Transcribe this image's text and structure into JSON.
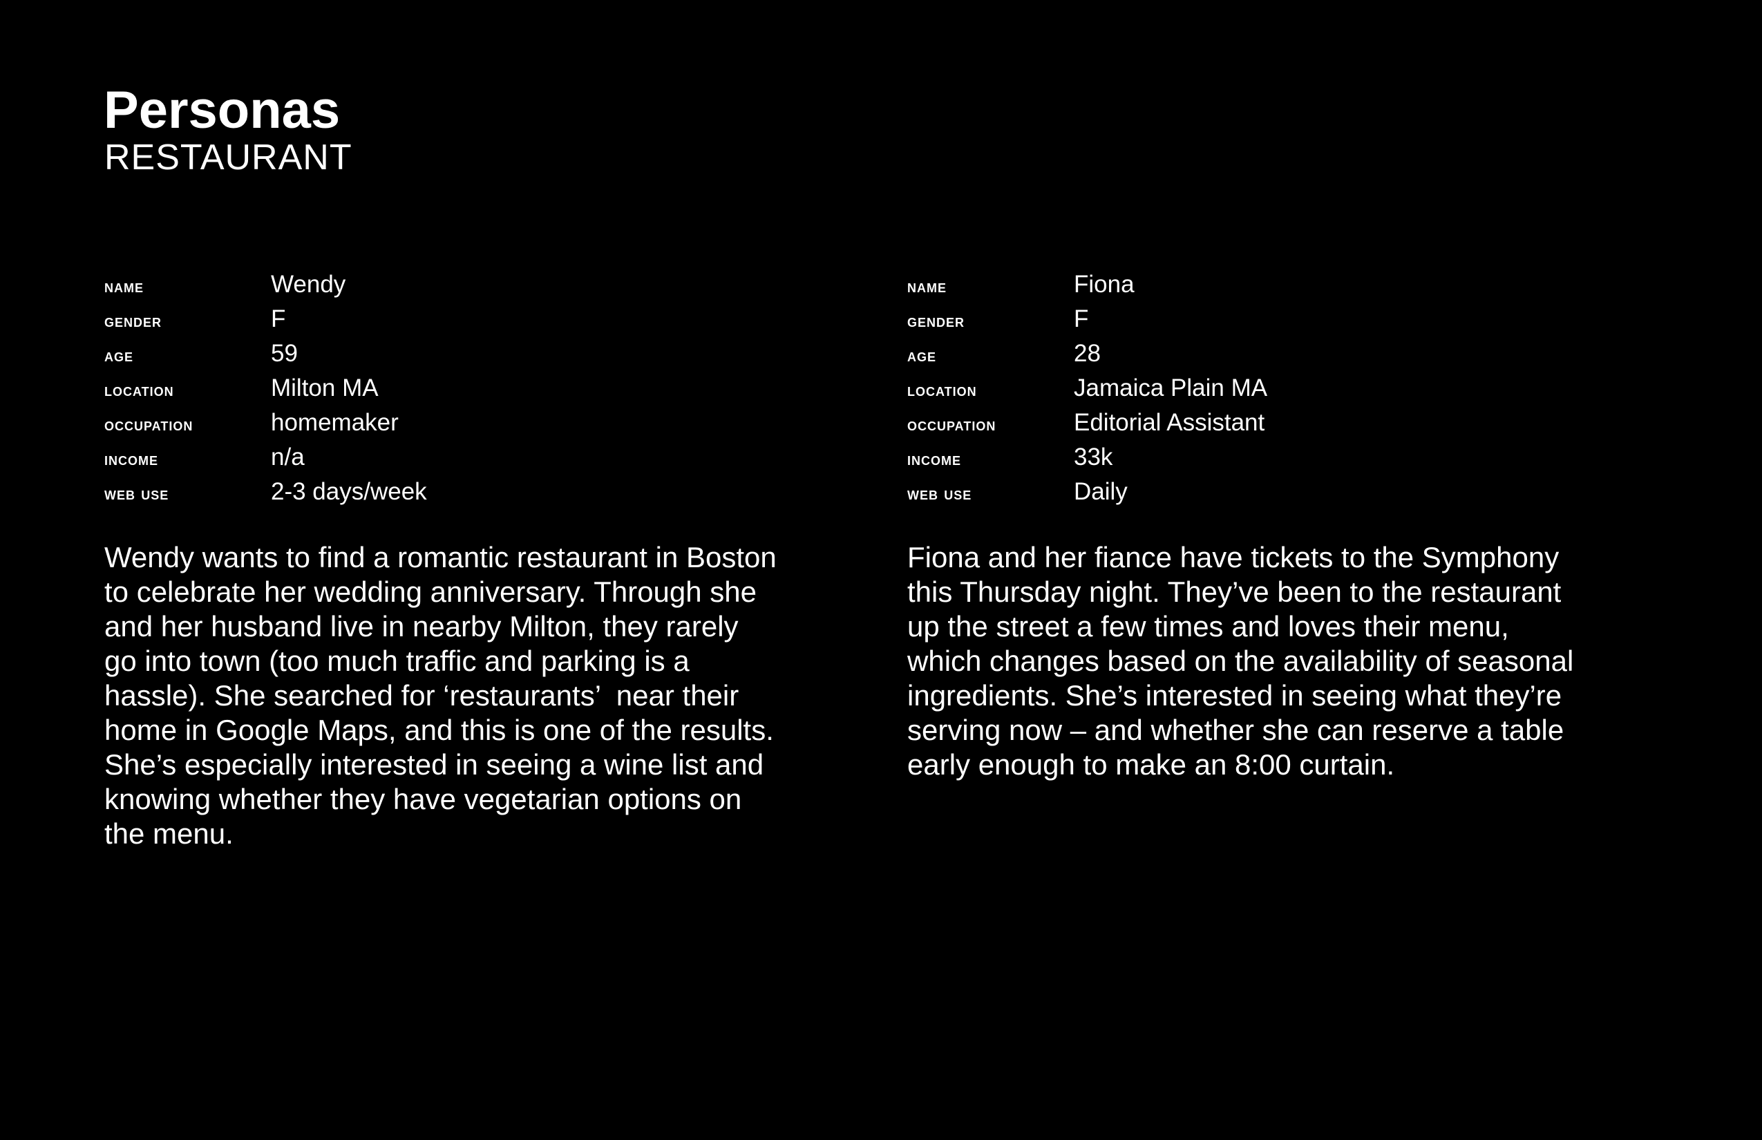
{
  "header": {
    "title": "Personas",
    "subtitle": "RESTAURANT"
  },
  "labels": {
    "name": "NAME",
    "gender": "GENDER",
    "age": "AGE",
    "location": "LOCATION",
    "occupation": "OCCUPATION",
    "income": "INCOME",
    "web_use": "WEB USE"
  },
  "personas": [
    {
      "name": "Wendy",
      "gender": "F",
      "age": "59",
      "location": "Milton MA",
      "occupation": "homemaker",
      "income": "n/a",
      "web_use": "2-3 days/week",
      "bio": "Wendy wants to find a romantic restaurant in Boston\nto celebrate her wedding anniversary. Through she\nand her husband live in nearby Milton, they rarely\ngo into town (too much traffic and parking is a\nhassle). She searched for ‘restaurants’  near their\nhome in Google Maps, and this is one of the results.\nShe’s especially interested in seeing a wine list and\nknowing whether they have vegetarian options on\nthe menu."
    },
    {
      "name": "Fiona",
      "gender": "F",
      "age": "28",
      "location": "Jamaica Plain MA",
      "occupation": "Editorial Assistant",
      "income": "33k",
      "web_use": "Daily",
      "bio": "Fiona and her fiance have tickets to the Symphony\nthis Thursday night. They’ve been to the restaurant\nup the street a few times and loves their menu,\nwhich changes based on the availability of seasonal\ningredients. She’s interested in seeing what they’re\nserving now – and whether she can reserve a table\nearly enough to make an 8:00 curtain."
    }
  ]
}
